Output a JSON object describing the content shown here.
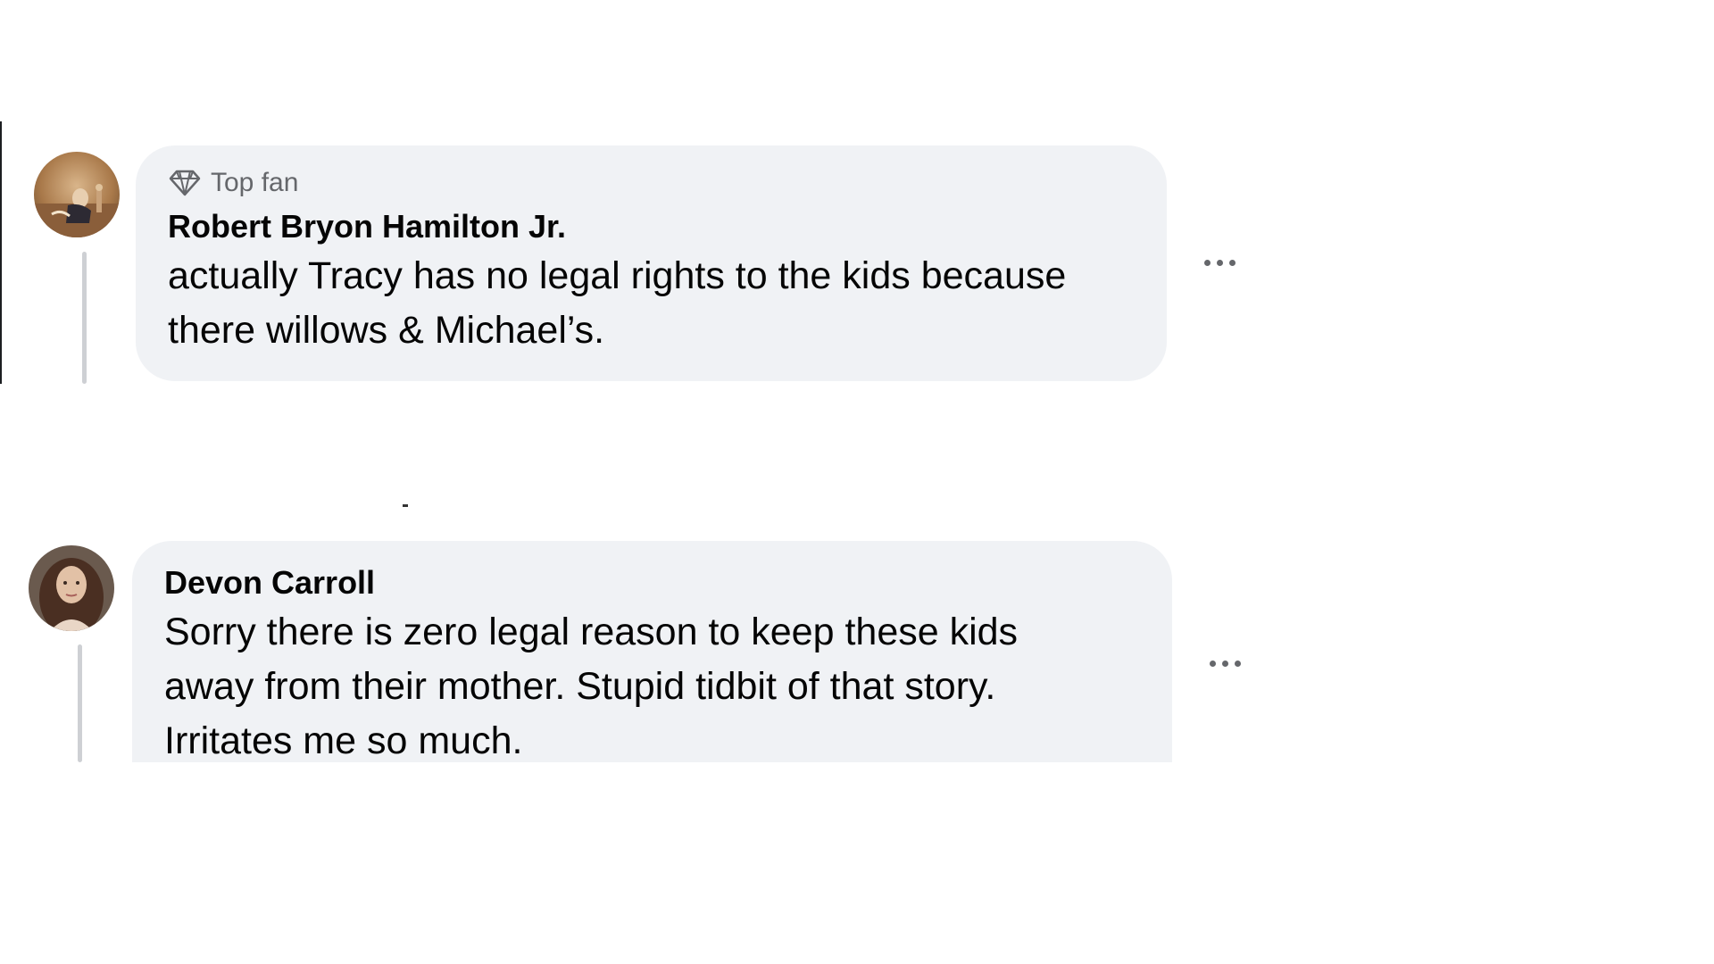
{
  "comments": [
    {
      "badge": "Top fan",
      "badge_icon": "diamond-icon",
      "author": "Robert Bryon Hamilton Jr.",
      "text_lines": [
        "actually Tracy has no legal rights to the kids because",
        "there willows & Michael’s."
      ]
    },
    {
      "author": "Devon Carroll",
      "text_lines": [
        "Sorry there is zero legal reason to keep these kids",
        "away from their mother. Stupid tidbit of that story.",
        "Irritates me so much."
      ]
    }
  ],
  "colors": {
    "bubble_bg": "#f0f2f5",
    "secondary_text": "#65676b",
    "primary_text": "#050505",
    "thread_line": "#ced0d4"
  }
}
